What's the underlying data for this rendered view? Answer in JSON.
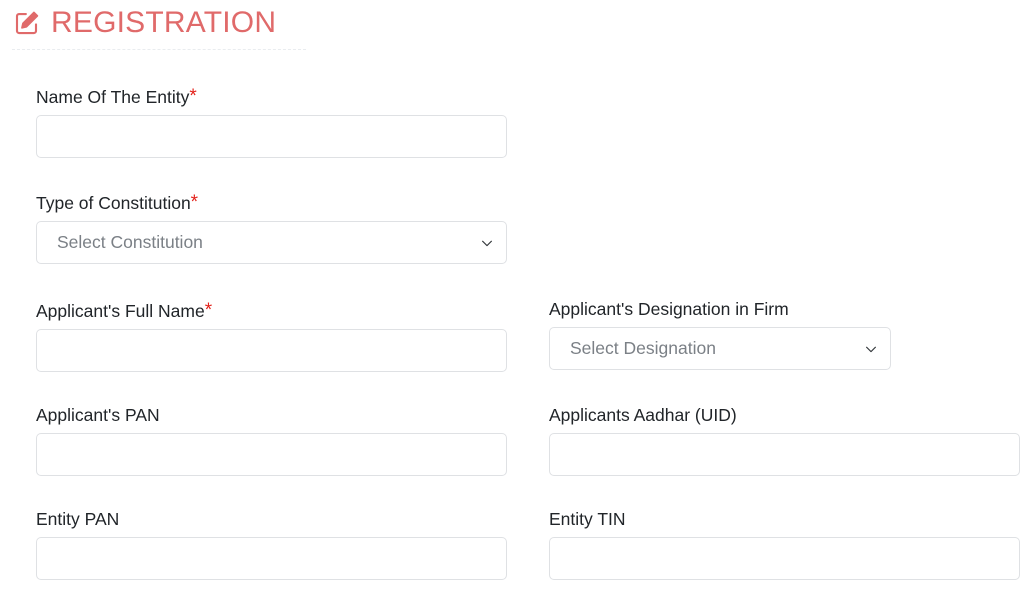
{
  "header": {
    "title": "REGISTRATION",
    "icon": "edit-pen-square-icon",
    "title_color": "#e06a6a",
    "divider_color": "#e9ecef"
  },
  "theme": {
    "required_asterisk_color": "#e3211a",
    "label_color": "#212529",
    "input_border_color": "#dfe1e4",
    "placeholder_color": "#7b8086",
    "background": "#ffffff"
  },
  "form": {
    "required_marker": "*",
    "fields": [
      {
        "id": "entity-name",
        "label": "Name Of The Entity",
        "required": true,
        "type": "text",
        "value": "",
        "placeholder": ""
      },
      {
        "id": "type-of-constitution",
        "label": "Type of Constitution",
        "required": true,
        "type": "select",
        "selected": "Select Constitution",
        "icon": "chevron-down-icon"
      },
      {
        "id": "applicant-full-name",
        "label": "Applicant's Full Name",
        "required": true,
        "type": "text",
        "value": "",
        "placeholder": ""
      },
      {
        "id": "applicant-designation",
        "label": "Applicant's Designation in Firm",
        "required": false,
        "type": "select",
        "selected": "Select Designation",
        "icon": "chevron-down-icon"
      },
      {
        "id": "applicant-pan",
        "label": "Applicant's PAN",
        "required": false,
        "type": "text",
        "value": "",
        "placeholder": ""
      },
      {
        "id": "applicant-aadhar",
        "label": "Applicants Aadhar (UID)",
        "required": false,
        "type": "text",
        "value": "",
        "placeholder": ""
      },
      {
        "id": "entity-pan",
        "label": "Entity PAN",
        "required": false,
        "type": "text",
        "value": "",
        "placeholder": ""
      },
      {
        "id": "entity-tin",
        "label": "Entity TIN",
        "required": false,
        "type": "text",
        "value": "",
        "placeholder": ""
      }
    ]
  }
}
